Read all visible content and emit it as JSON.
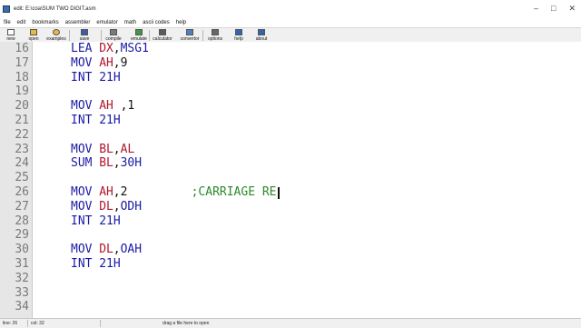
{
  "window": {
    "title": "edit: E:\\coa\\SUM TWO DIGIT.asm"
  },
  "menu": [
    "file",
    "edit",
    "bookmarks",
    "assembler",
    "emulator",
    "math",
    "ascii codes",
    "help"
  ],
  "toolbar": [
    {
      "label": "new",
      "icon": "new-file-icon",
      "color": "#ffffff"
    },
    {
      "label": "open",
      "icon": "open-folder-icon",
      "color": "#e8b840"
    },
    {
      "label": "examples",
      "icon": "star-icon",
      "color": "#e8b840"
    },
    {
      "label": "save",
      "icon": "floppy-disk-icon",
      "color": "#3a5fa8"
    },
    {
      "label": "compile",
      "icon": "compile-icon",
      "color": "#7a7a7a"
    },
    {
      "label": "emulate",
      "icon": "emulate-icon",
      "color": "#3c9a3c"
    },
    {
      "label": "calculator",
      "icon": "calculator-icon",
      "color": "#5a5a5a"
    },
    {
      "label": "convertor",
      "icon": "convertor-icon",
      "color": "#4a7fc0"
    },
    {
      "label": "options",
      "icon": "wrench-icon",
      "color": "#666666"
    },
    {
      "label": "help",
      "icon": "help-icon",
      "color": "#2f66b3"
    },
    {
      "label": "about",
      "icon": "about-icon",
      "color": "#2f66b3"
    }
  ],
  "code_lines": [
    {
      "n": "16",
      "tokens": [
        {
          "t": "LEA",
          "c": "kw",
          "col": 0
        },
        {
          "t": "DX",
          "c": "reg",
          "col": 4
        },
        {
          "t": ",",
          "c": "num",
          "col": 6
        },
        {
          "t": "MSG1",
          "c": "kw",
          "col": 7
        }
      ]
    },
    {
      "n": "17",
      "tokens": [
        {
          "t": "MOV",
          "c": "kw",
          "col": 0
        },
        {
          "t": "AH",
          "c": "reg",
          "col": 4
        },
        {
          "t": ",",
          "c": "num",
          "col": 6
        },
        {
          "t": "9",
          "c": "num",
          "col": 7
        }
      ]
    },
    {
      "n": "18",
      "tokens": [
        {
          "t": "INT",
          "c": "kw",
          "col": 0
        },
        {
          "t": "21H",
          "c": "kw",
          "col": 4
        }
      ]
    },
    {
      "n": "19",
      "tokens": []
    },
    {
      "n": "20",
      "tokens": [
        {
          "t": "MOV",
          "c": "kw",
          "col": 0
        },
        {
          "t": "AH",
          "c": "reg",
          "col": 4
        },
        {
          "t": ",",
          "c": "num",
          "col": 7
        },
        {
          "t": "1",
          "c": "num",
          "col": 8
        }
      ]
    },
    {
      "n": "21",
      "tokens": [
        {
          "t": "INT",
          "c": "kw",
          "col": 0
        },
        {
          "t": "21H",
          "c": "kw",
          "col": 4
        }
      ]
    },
    {
      "n": "22",
      "tokens": []
    },
    {
      "n": "23",
      "tokens": [
        {
          "t": "MOV",
          "c": "kw",
          "col": 0
        },
        {
          "t": "BL",
          "c": "reg",
          "col": 4
        },
        {
          "t": ",",
          "c": "num",
          "col": 6
        },
        {
          "t": "AL",
          "c": "reg",
          "col": 7
        }
      ]
    },
    {
      "n": "24",
      "tokens": [
        {
          "t": "SUM",
          "c": "kw",
          "col": 0
        },
        {
          "t": "BL",
          "c": "reg",
          "col": 4
        },
        {
          "t": ",",
          "c": "num",
          "col": 6
        },
        {
          "t": "30H",
          "c": "kw",
          "col": 7
        }
      ]
    },
    {
      "n": "25",
      "tokens": []
    },
    {
      "n": "26",
      "tokens": [
        {
          "t": "MOV",
          "c": "kw",
          "col": 0
        },
        {
          "t": "AH",
          "c": "reg",
          "col": 4
        },
        {
          "t": ",",
          "c": "num",
          "col": 6
        },
        {
          "t": "2",
          "c": "num",
          "col": 7
        },
        {
          "t": ";CARRIAGE RE",
          "c": "cmt",
          "col": 17
        }
      ],
      "caret": true
    },
    {
      "n": "27",
      "tokens": [
        {
          "t": "MOV",
          "c": "kw",
          "col": 0
        },
        {
          "t": "DL",
          "c": "reg",
          "col": 4
        },
        {
          "t": ",",
          "c": "num",
          "col": 6
        },
        {
          "t": "ODH",
          "c": "kw",
          "col": 7
        }
      ]
    },
    {
      "n": "28",
      "tokens": [
        {
          "t": "INT",
          "c": "kw",
          "col": 0
        },
        {
          "t": "21H",
          "c": "kw",
          "col": 4
        }
      ]
    },
    {
      "n": "29",
      "tokens": []
    },
    {
      "n": "30",
      "tokens": [
        {
          "t": "MOV",
          "c": "kw",
          "col": 0
        },
        {
          "t": "DL",
          "c": "reg",
          "col": 4
        },
        {
          "t": ",",
          "c": "num",
          "col": 6
        },
        {
          "t": "OAH",
          "c": "kw",
          "col": 7
        }
      ]
    },
    {
      "n": "31",
      "tokens": [
        {
          "t": "INT",
          "c": "kw",
          "col": 0
        },
        {
          "t": "21H",
          "c": "kw",
          "col": 4
        }
      ]
    },
    {
      "n": "32",
      "tokens": []
    },
    {
      "n": "33",
      "tokens": []
    },
    {
      "n": "34",
      "tokens": []
    }
  ],
  "status": {
    "line": "line: 26",
    "col": "col: 32",
    "hint": "drag a file here to open"
  }
}
